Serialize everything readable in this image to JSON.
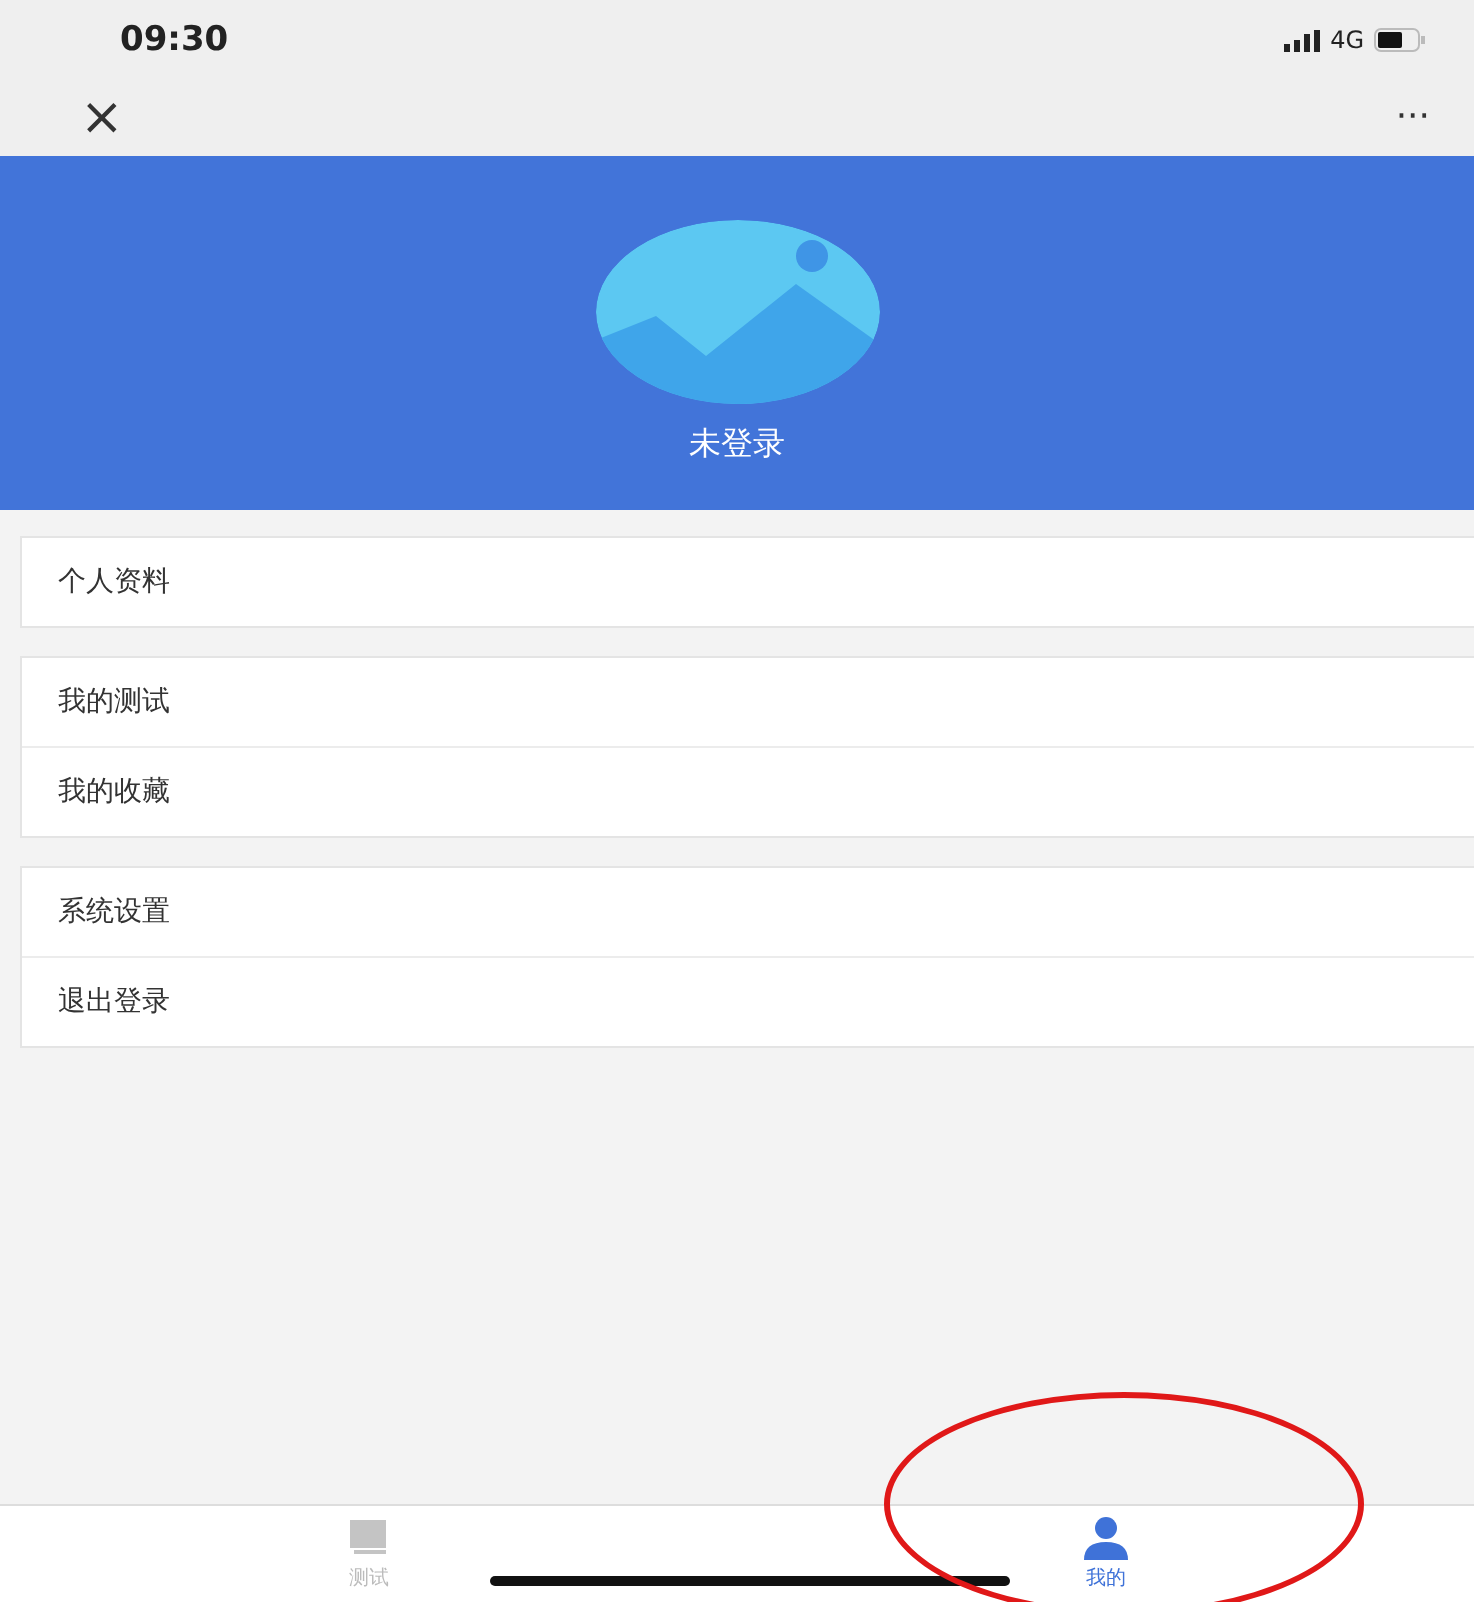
{
  "status_bar": {
    "time": "09:30",
    "network": "4G"
  },
  "nav": {
    "close": "×",
    "more": "···"
  },
  "profile": {
    "name": "未登录"
  },
  "groups": [
    {
      "items": [
        {
          "label": "个人资料"
        }
      ]
    },
    {
      "items": [
        {
          "label": "我的测试"
        },
        {
          "label": "我的收藏"
        }
      ]
    },
    {
      "items": [
        {
          "label": "系统设置"
        },
        {
          "label": "退出登录"
        }
      ]
    }
  ],
  "tabs": [
    {
      "label": "测试",
      "kind": "chat",
      "selected": false
    },
    {
      "label": "我的",
      "kind": "person",
      "selected": true
    }
  ]
}
